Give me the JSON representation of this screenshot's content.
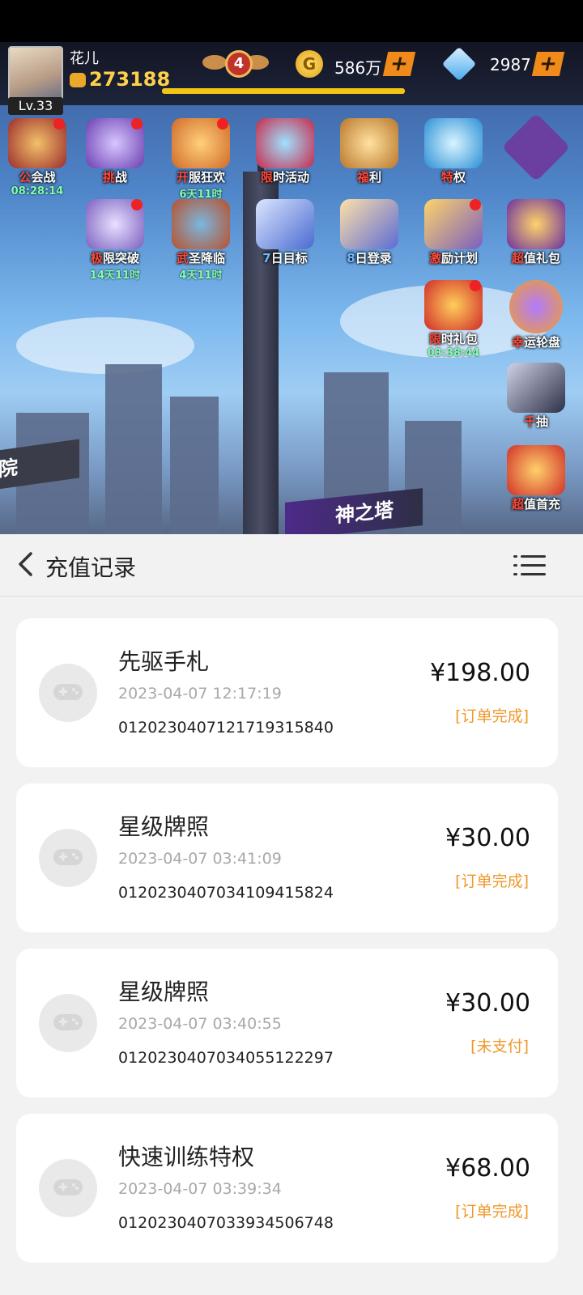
{
  "game": {
    "player_name": "花儿",
    "level": "Lv.33",
    "power": "273188",
    "rank": "4",
    "gold": "586万",
    "gems": "2987",
    "icons_row1": [
      {
        "prefix": "公",
        "rest": "会战",
        "timer": "08:28:14"
      },
      {
        "prefix": "挑",
        "rest": "战",
        "timer": ""
      },
      {
        "prefix": "开",
        "rest": "服狂欢",
        "timer": "6天11时"
      },
      {
        "prefix": "限",
        "rest": "时活动",
        "timer": ""
      },
      {
        "prefix": "福",
        "rest": "利",
        "timer": ""
      },
      {
        "prefix": "特",
        "rest": "权",
        "timer": ""
      }
    ],
    "icons_row2": [
      {
        "prefix": "极",
        "rest": "限突破",
        "timer": "14天11时"
      },
      {
        "prefix": "武",
        "rest": "圣降临",
        "timer": "4天11时"
      },
      {
        "prefix": "7",
        "rest": "日目标",
        "timer": ""
      },
      {
        "prefix": "8",
        "rest": "日登录",
        "timer": ""
      },
      {
        "prefix": "激",
        "rest": "励计划",
        "timer": ""
      },
      {
        "prefix": "超",
        "rest": "值礼包",
        "timer": ""
      }
    ],
    "icons_side": [
      {
        "prefix": "限",
        "rest": "时礼包",
        "timer": "03:38:44"
      },
      {
        "prefix": "幸",
        "rest": "运轮盘",
        "timer": ""
      },
      {
        "prefix": "千",
        "rest": "抽",
        "timer": ""
      },
      {
        "prefix": "超",
        "rest": "值首充",
        "timer": ""
      }
    ],
    "banner_left": "院",
    "banner_tower": "神之塔"
  },
  "header": {
    "title": "充值记录"
  },
  "records": [
    {
      "name": "先驱手札",
      "time": "2023-04-07 12:17:19",
      "order": "0120230407121719315840",
      "price": "¥198.00",
      "status": "[订单完成]"
    },
    {
      "name": "星级牌照",
      "time": "2023-04-07 03:41:09",
      "order": "0120230407034109415824",
      "price": "¥30.00",
      "status": "[订单完成]"
    },
    {
      "name": "星级牌照",
      "time": "2023-04-07 03:40:55",
      "order": "0120230407034055122297",
      "price": "¥30.00",
      "status": "[未支付]"
    },
    {
      "name": "快速训练特权",
      "time": "2023-04-07 03:39:34",
      "order": "0120230407033934506748",
      "price": "¥68.00",
      "status": "[订单完成]"
    }
  ],
  "colors": {
    "accent": "#f0982a",
    "title": "#222222"
  }
}
